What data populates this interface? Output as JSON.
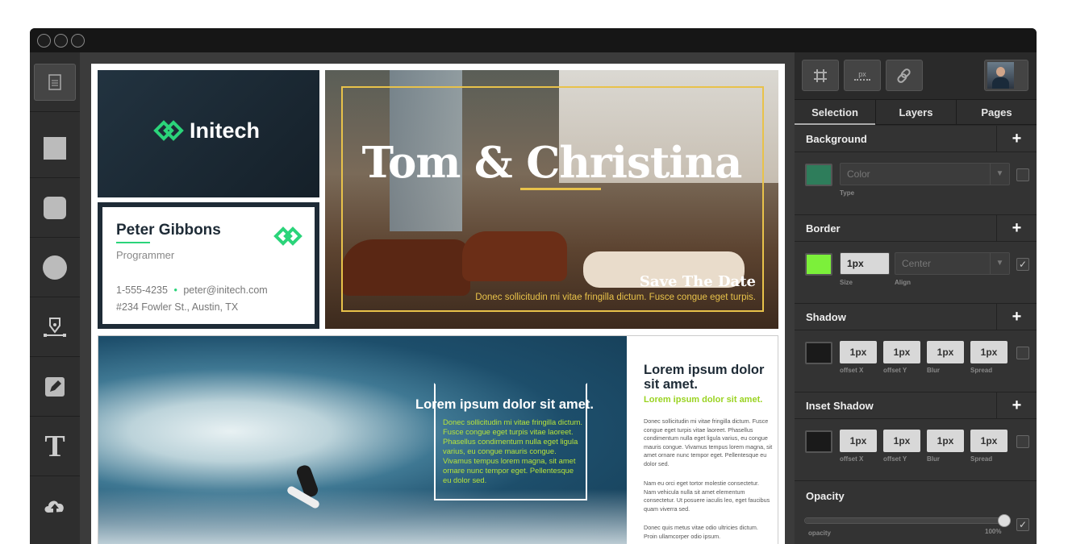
{
  "window": {
    "traffic_lights": [
      "close",
      "minimize",
      "zoom"
    ]
  },
  "toolbar": {
    "items": [
      {
        "name": "document-icon"
      },
      {
        "name": "rectangle-icon"
      },
      {
        "name": "rounded-rectangle-icon"
      },
      {
        "name": "circle-icon"
      },
      {
        "name": "pen-tool-icon"
      },
      {
        "name": "pencil-icon"
      },
      {
        "name": "text-tool-icon",
        "label": "T"
      },
      {
        "name": "upload-icon"
      }
    ]
  },
  "canvas": {
    "initech_card": {
      "logo_text": "Initech",
      "bg": "#1e2b36",
      "accent": "#2bd47a"
    },
    "business_card": {
      "name": "Peter Gibbons",
      "title": "Programmer",
      "phone": "1-555-4235",
      "bullet": "•",
      "email": "peter@initech.com",
      "address": "#234 Fowler St., Austin, TX"
    },
    "wedding_card": {
      "title": "Tom & Christina",
      "subtitle": "Save The Date",
      "body": "Donec sollicitudin mi vitae fringilla dictum. Fusce congue eget turpis.",
      "accent": "#e8c24a"
    },
    "surf_card": {
      "overlay_title": "Lorem ipsum dolor sit amet.",
      "overlay_body": "Donec sollicitudin mi vitae fringilla dictum. Fusce congue eget turpis vitae laoreet. Phasellus condimentum nulla eget ligula varius, eu congue mauris congue. Vivamus tempus lorem magna, sit amet ornare nunc tempor eget. Pellentesque eu dolor sed.",
      "side_title": "Lorem ipsum dolor sit amet.",
      "side_subtitle": "Lorem ipsum dolor sit amet.",
      "side_p1": "Donec sollicitudin mi vitae fringilla dictum. Fusce congue eget turpis vitae laoreet. Phasellus condimentum nulla eget ligula varius, eu congue mauris congue. Vivamus tempus lorem magna, sit amet ornare nunc tempor eget. Pellentesque eu dolor sed.",
      "side_p2": "Nam eu orci eget tortor molestie consectetur. Nam vehicula nulla sit amet elementum consectetur. Ut posuere iaculis leo, eget faucibus quam viverra sed.",
      "side_p3": "Donec quis metus vitae odio ultricies dictum. Proin ullamcorper odio ipsum.",
      "accent": "#9ad321"
    }
  },
  "panel": {
    "top_buttons": [
      {
        "name": "grid-icon"
      },
      {
        "name": "px-ruler-icon",
        "label": "px"
      },
      {
        "name": "link-icon"
      }
    ],
    "tabs": [
      "Selection",
      "Layers",
      "Pages"
    ],
    "active_tab": "Selection",
    "background": {
      "title": "Background",
      "swatch": "#2e7d5b",
      "type_value": "Color",
      "type_caption": "Type"
    },
    "border": {
      "title": "Border",
      "swatch": "#7cf03a",
      "size": "1px",
      "size_caption": "Size",
      "align": "Center",
      "align_caption": "Align",
      "enabled": "✓"
    },
    "shadow": {
      "title": "Shadow",
      "swatch": "#1a1a1a",
      "values": [
        "1px",
        "1px",
        "1px",
        "1px"
      ],
      "captions": [
        "offset X",
        "offset Y",
        "Blur",
        "Spread"
      ]
    },
    "inset_shadow": {
      "title": "Inset Shadow",
      "swatch": "#1a1a1a",
      "values": [
        "1px",
        "1px",
        "1px",
        "1px"
      ],
      "captions": [
        "offset X",
        "offset Y",
        "Blur",
        "Spread"
      ]
    },
    "opacity": {
      "title": "Opacity",
      "caption": "opacity",
      "value_label": "100%",
      "value": 1.0,
      "enabled": "✓"
    },
    "plus": "+"
  }
}
